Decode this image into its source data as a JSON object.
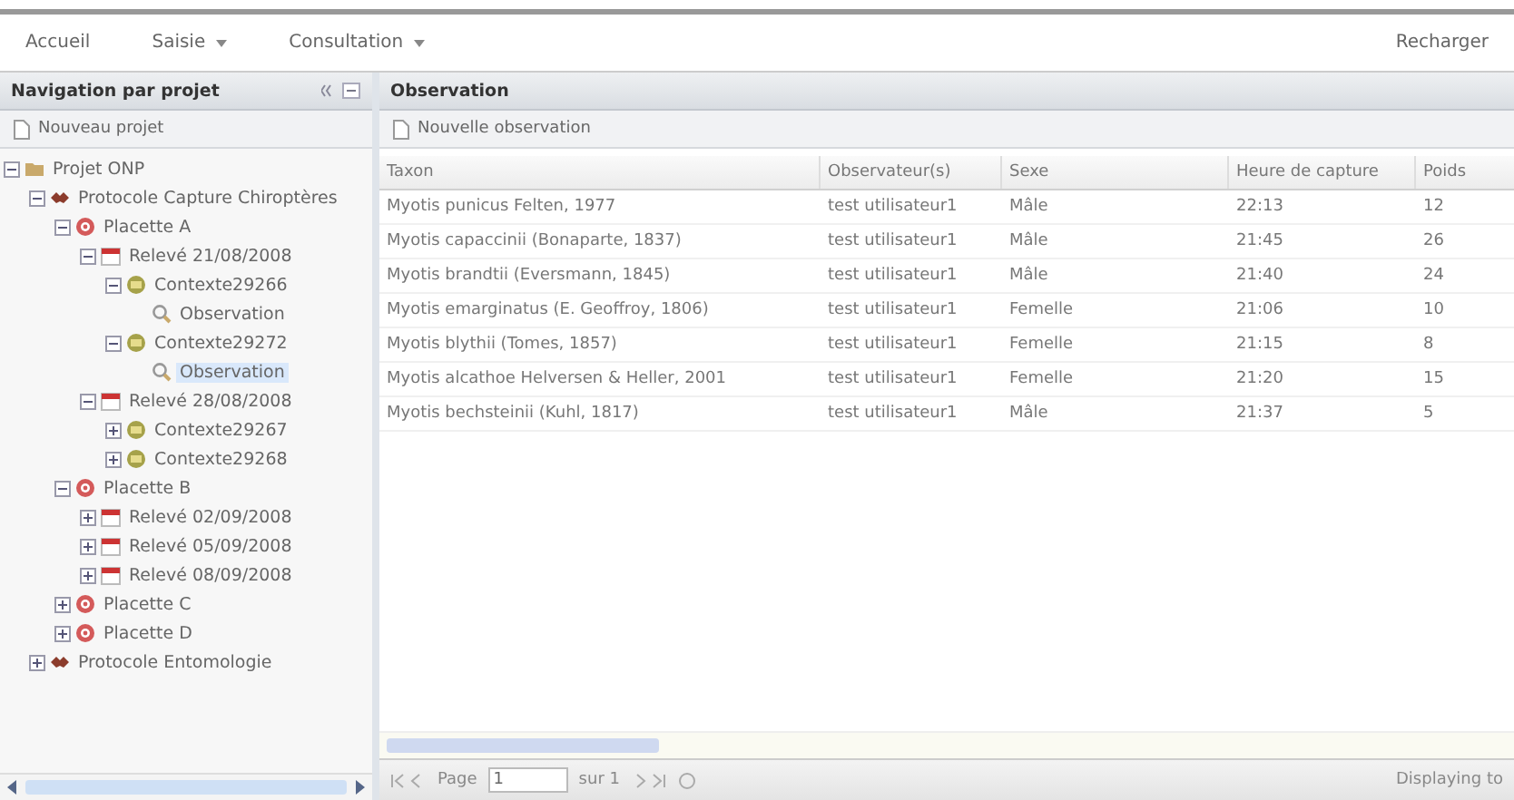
{
  "menu": {
    "items": [
      {
        "label": "Accueil",
        "dropdown": false
      },
      {
        "label": "Saisie",
        "dropdown": true
      },
      {
        "label": "Consultation",
        "dropdown": true
      }
    ],
    "right": "Recharger"
  },
  "navigation": {
    "title": "Navigation par projet",
    "new_button": "Nouveau projet",
    "tree": [
      {
        "kind": "project",
        "label": "Projet ONP",
        "expanded": true,
        "selected": false,
        "children": [
          {
            "kind": "protocol",
            "label": "Protocole Capture Chiroptères",
            "expanded": true,
            "selected": false,
            "children": [
              {
                "kind": "placette",
                "label": "Placette A",
                "expanded": true,
                "selected": false,
                "children": [
                  {
                    "kind": "releve",
                    "label": "Relevé 21/08/2008",
                    "expanded": true,
                    "selected": false,
                    "children": [
                      {
                        "kind": "contexte",
                        "label": "Contexte29266",
                        "expanded": true,
                        "selected": false,
                        "children": [
                          {
                            "kind": "observation",
                            "label": "Observation",
                            "selected": false
                          }
                        ]
                      },
                      {
                        "kind": "contexte",
                        "label": "Contexte29272",
                        "expanded": true,
                        "selected": false,
                        "children": [
                          {
                            "kind": "observation",
                            "label": "Observation",
                            "selected": true
                          }
                        ]
                      }
                    ]
                  },
                  {
                    "kind": "releve",
                    "label": "Relevé 28/08/2008",
                    "expanded": true,
                    "selected": false,
                    "children": [
                      {
                        "kind": "contexte",
                        "label": "Contexte29267",
                        "expanded": false,
                        "selected": false
                      },
                      {
                        "kind": "contexte",
                        "label": "Contexte29268",
                        "expanded": false,
                        "selected": false
                      }
                    ]
                  }
                ]
              },
              {
                "kind": "placette",
                "label": "Placette B",
                "expanded": true,
                "selected": false,
                "children": [
                  {
                    "kind": "releve",
                    "label": "Relevé 02/09/2008",
                    "expanded": false,
                    "selected": false
                  },
                  {
                    "kind": "releve",
                    "label": "Relevé 05/09/2008",
                    "expanded": false,
                    "selected": false
                  },
                  {
                    "kind": "releve",
                    "label": "Relevé 08/09/2008",
                    "expanded": false,
                    "selected": false
                  }
                ]
              },
              {
                "kind": "placette",
                "label": "Placette C",
                "expanded": false,
                "selected": false
              },
              {
                "kind": "placette",
                "label": "Placette D",
                "expanded": false,
                "selected": false
              }
            ]
          },
          {
            "kind": "protocol",
            "label": "Protocole Entomologie",
            "expanded": false,
            "selected": false
          }
        ]
      }
    ]
  },
  "observation": {
    "title": "Observation",
    "new_button": "Nouvelle observation",
    "columns": [
      "Taxon",
      "Observateur(s)",
      "Sexe",
      "Heure de capture",
      "Poids"
    ],
    "rows": [
      [
        "Myotis punicus Felten, 1977",
        "test utilisateur1",
        "Mâle",
        "22:13",
        "12"
      ],
      [
        "Myotis capaccinii (Bonaparte, 1837)",
        "test utilisateur1",
        "Mâle",
        "21:45",
        "26"
      ],
      [
        "Myotis brandtii (Eversmann, 1845)",
        "test utilisateur1",
        "Mâle",
        "21:40",
        "24"
      ],
      [
        "Myotis emarginatus (E. Geoffroy, 1806)",
        "test utilisateur1",
        "Femelle",
        "21:06",
        "10"
      ],
      [
        "Myotis blythii (Tomes, 1857)",
        "test utilisateur1",
        "Femelle",
        "21:15",
        "8"
      ],
      [
        "Myotis alcathoe Helversen & Heller, 2001",
        "test utilisateur1",
        "Femelle",
        "21:20",
        "15"
      ],
      [
        "Myotis bechsteinii (Kuhl, 1817)",
        "test utilisateur1",
        "Mâle",
        "21:37",
        "5"
      ]
    ],
    "pager": {
      "page_label": "Page",
      "page_value": "1",
      "of_label": "sur 1",
      "status": "Displaying to"
    }
  }
}
